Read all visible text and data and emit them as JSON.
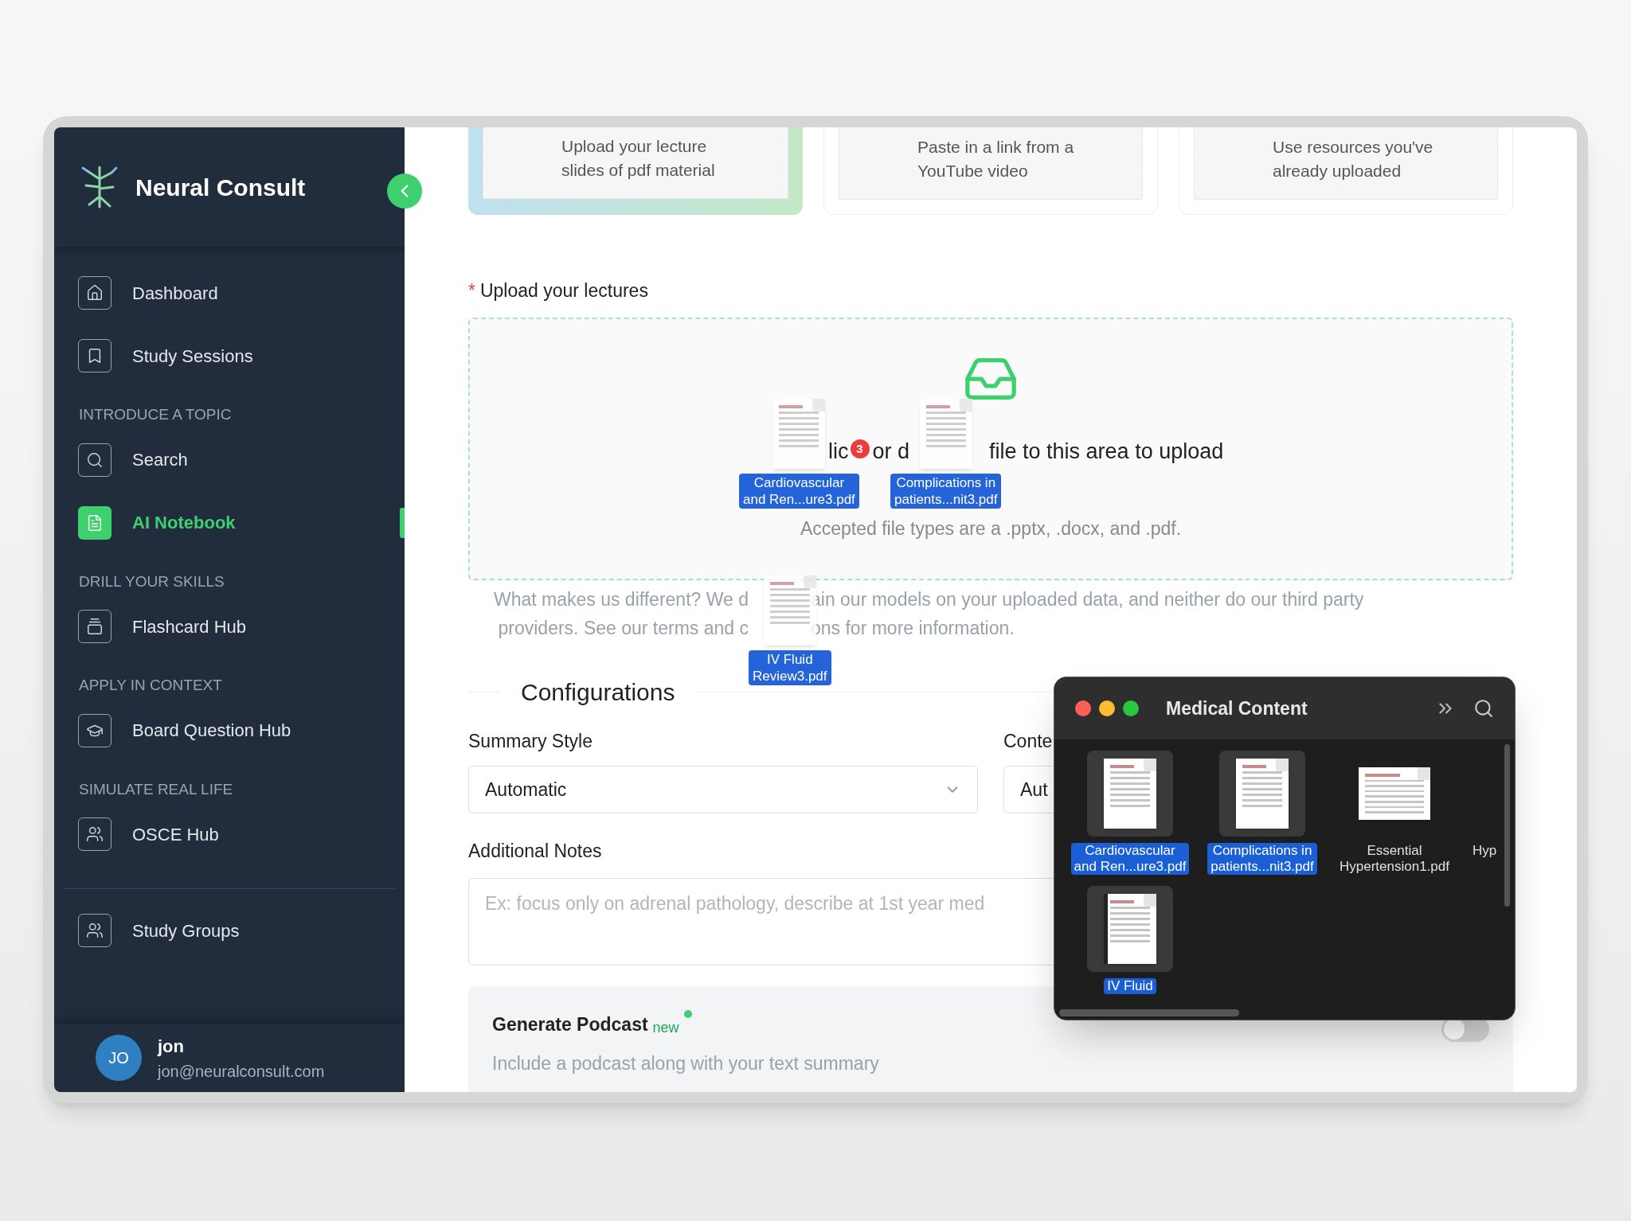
{
  "sidebar": {
    "brand": "Neural Consult",
    "groups": [
      {
        "items": [
          {
            "label": "Dashboard",
            "selected": false
          },
          {
            "label": "Study Sessions",
            "selected": false
          }
        ]
      },
      {
        "heading": "INTRODUCE A TOPIC",
        "items": [
          {
            "label": "Search",
            "selected": false
          },
          {
            "label": "AI Notebook",
            "selected": true
          }
        ]
      },
      {
        "heading": "DRILL YOUR SKILLS",
        "items": [
          {
            "label": "Flashcard Hub",
            "selected": false
          }
        ]
      },
      {
        "heading": "APPLY IN CONTEXT",
        "items": [
          {
            "label": "Board Question Hub",
            "selected": false
          }
        ]
      },
      {
        "heading": "SIMULATE REAL LIFE",
        "items": [
          {
            "label": "OSCE Hub",
            "selected": false
          }
        ]
      }
    ],
    "bottom_items": [
      {
        "label": "Study Groups",
        "selected": false
      }
    ],
    "user": {
      "initials": "JO",
      "name": "jon",
      "email": "jon@neuralconsult.com"
    }
  },
  "source_cards": [
    {
      "text": "Upload your lecture slides of pdf material",
      "selected": true
    },
    {
      "text": "Paste in a link from a YouTube video",
      "selected": false
    },
    {
      "text": "Use resources you've already uploaded",
      "selected": false
    }
  ],
  "upload": {
    "required_mark": "*",
    "label": "Upload your lectures",
    "title_parts": [
      "lic",
      "or d",
      "file to this area to upload"
    ],
    "hint": "Accepted file types are a .pptx, .docx, and .pdf."
  },
  "privacy": {
    "line_1": [
      "What makes us different? We d",
      "ain our models on your uploaded data, and neither do our third party"
    ],
    "line_2": [
      "providers. See our terms and c",
      "ons for more information."
    ]
  },
  "drag": {
    "count": "3",
    "files": [
      {
        "name_lines": [
          "Cardiovascular",
          "and Ren...ure3.pdf"
        ]
      },
      {
        "name_lines": [
          "Complications in",
          "patients...nit3.pdf"
        ]
      },
      {
        "name_lines": [
          "IV Fluid",
          "Review3.pdf"
        ]
      }
    ]
  },
  "configurations": {
    "heading": "Configurations",
    "summary_label": "Summary Style",
    "summary_value": "Automatic",
    "content_label": "Conte",
    "content_value": "Aut",
    "notes_label": "Additional Notes",
    "notes_placeholder": "Ex: focus only on adrenal pathology, describe at 1st year med"
  },
  "podcast": {
    "title": "Generate Podcast",
    "badge": "new",
    "description": "Include a podcast along with your text summary",
    "on": false
  },
  "finder": {
    "title": "Medical Content",
    "files": [
      {
        "name_lines": [
          "Cardiovascular",
          "and Ren...ure3.pdf"
        ],
        "selected": true
      },
      {
        "name_lines": [
          "Complications in",
          "patients...nit3.pdf"
        ],
        "selected": true
      },
      {
        "name_lines": [
          "Essential",
          "Hypertension1.pdf"
        ],
        "selected": false
      },
      {
        "name_lines": [
          "Hyp"
        ],
        "selected": false
      },
      {
        "name_lines": [
          "IV Fluid"
        ],
        "selected": true
      }
    ]
  }
}
